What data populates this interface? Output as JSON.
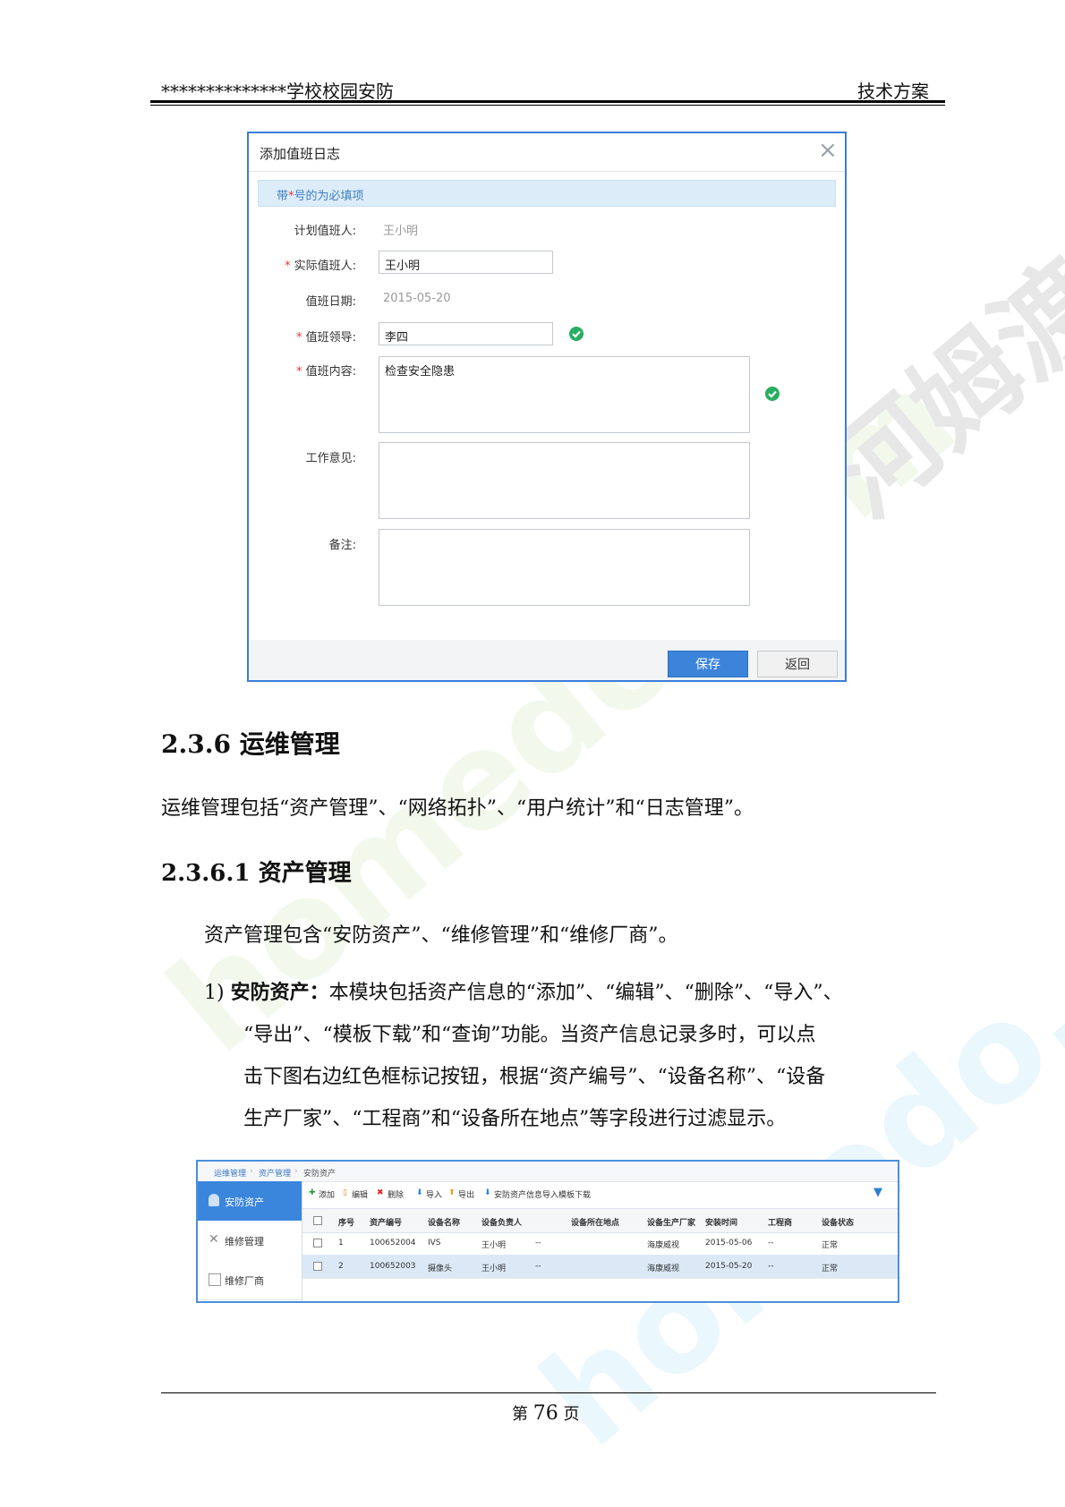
{
  "header": {
    "left": "**************学校校园安防",
    "right": "技术方案"
  },
  "dialog": {
    "title": "添加值班日志",
    "required_note_prefix": "带",
    "required_note_star": "*",
    "required_note_suffix": "号的为必填项",
    "fields": {
      "planned_staff": {
        "label": "计划值班人:",
        "value": "王小明"
      },
      "actual_staff": {
        "star": "*",
        "label": "实际值班人:",
        "value": "王小明"
      },
      "duty_date": {
        "label": "值班日期:",
        "value": "2015-05-20"
      },
      "duty_leader": {
        "star": "*",
        "label": "值班领导:",
        "value": "李四"
      },
      "duty_content": {
        "star": "*",
        "label": "值班内容:",
        "value": "检查安全隐患"
      },
      "work_opinion": {
        "label": "工作意见:",
        "value": ""
      },
      "remark": {
        "label": "备注:",
        "value": ""
      }
    },
    "save_label": "保存",
    "back_label": "返回"
  },
  "section_236": {
    "heading": "2.3.6 运维管理",
    "text": "运维管理包括“资产管理”、“网络拓扑”、“用户统计”和“日志管理”。"
  },
  "section_2361": {
    "heading": "2.3.6.1 资产管理",
    "text": "资产管理包含“安防资产”、“维修管理”和“维修厂商”。",
    "item_number": "1)",
    "item_bold": "安防资产：",
    "item_line1": "本模块包括资产信息的“添加”、“编辑”、“删除”、“导入”、",
    "item_line2": "“导出”、“模板下载”和“查询”功能。当资产信息记录多时，可以点",
    "item_line3": "击下图右边红色框标记按钮，根据“资产编号”、“设备名称”、“设备",
    "item_line4": "生产厂家”、“工程商”和“设备所在地点”等字段进行过滤显示。"
  },
  "asset_ui": {
    "breadcrumb": [
      "运维管理",
      "资产管理",
      "安防资产"
    ],
    "sidebar": [
      "安防资产",
      "维修管理",
      "维修厂商"
    ],
    "toolbar": [
      "添加",
      "编辑",
      "删除",
      "导入",
      "导出",
      "安防资产信息导入模板下载"
    ],
    "columns": [
      "序号",
      "资产编号",
      "设备名称",
      "设备负责人",
      "设备所在地点",
      "设备生产厂家",
      "安装时间",
      "工程商",
      "设备状态"
    ],
    "rows": [
      [
        "1",
        "100652004",
        "IVS",
        "王小明",
        "--",
        "海康威视",
        "2015-05-06",
        "--",
        "正常"
      ],
      [
        "2",
        "100652003",
        "摄像头",
        "王小明",
        "--",
        "海康威视",
        "2015-05-20",
        "--",
        "正常"
      ]
    ]
  },
  "footer": {
    "prefix": "第",
    "page": "76",
    "suffix": "页"
  },
  "watermark": {
    "text": "homedo.com",
    "cn": "河姆渡"
  }
}
